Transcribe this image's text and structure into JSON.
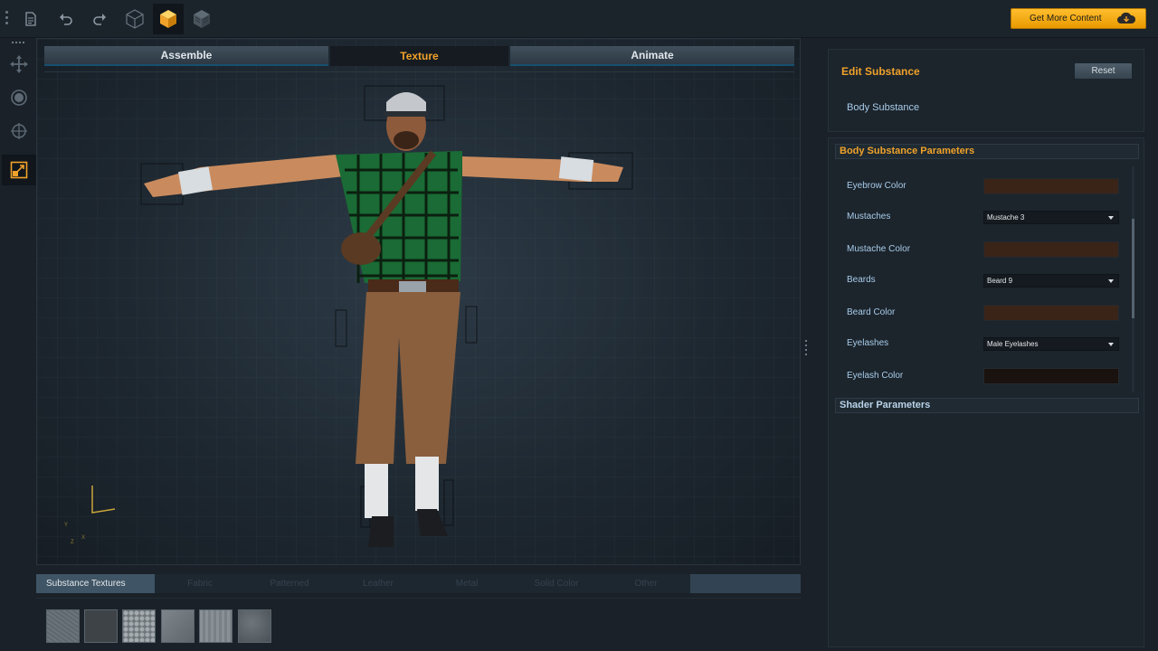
{
  "toolbar": {
    "get_more_label": "Get More Content",
    "icons": [
      "file-icon",
      "undo-icon",
      "redo-icon",
      "wireframe-cube-icon",
      "solid-cube-icon",
      "textured-cube-icon"
    ]
  },
  "modes": [
    {
      "label": "Assemble",
      "active": false
    },
    {
      "label": "Texture",
      "active": true
    },
    {
      "label": "Animate",
      "active": false
    }
  ],
  "axis": {
    "y": "Y",
    "x": "X",
    "z": "Z"
  },
  "substance": {
    "title": "Edit Substance",
    "reset_label": "Reset",
    "selected": "Body Substance",
    "params_title": "Body Substance Parameters",
    "shader_title": "Shader Parameters",
    "params": [
      {
        "label": "Eyebrow Color",
        "type": "color",
        "color": "#3a2418"
      },
      {
        "label": "Mustaches",
        "type": "dropdown",
        "value": "Mustache 3"
      },
      {
        "label": "Mustache Color",
        "type": "color",
        "color": "#3a2418"
      },
      {
        "label": "Beards",
        "type": "dropdown",
        "value": "Beard 9"
      },
      {
        "label": "Beard Color",
        "type": "color",
        "color": "#3a2418"
      },
      {
        "label": "Eyelashes",
        "type": "dropdown",
        "value": "Male Eyelashes"
      },
      {
        "label": "Eyelash Color",
        "type": "color",
        "color": "#1a120e"
      }
    ]
  },
  "library": {
    "tabs": [
      "Substance Textures",
      "Fabric",
      "Patterned",
      "Leather",
      "Metal",
      "Solid Color",
      "Other"
    ],
    "active_tab": "Substance Textures"
  },
  "colors": {
    "accent": "#f0a22a",
    "label": "#a8cdea"
  }
}
